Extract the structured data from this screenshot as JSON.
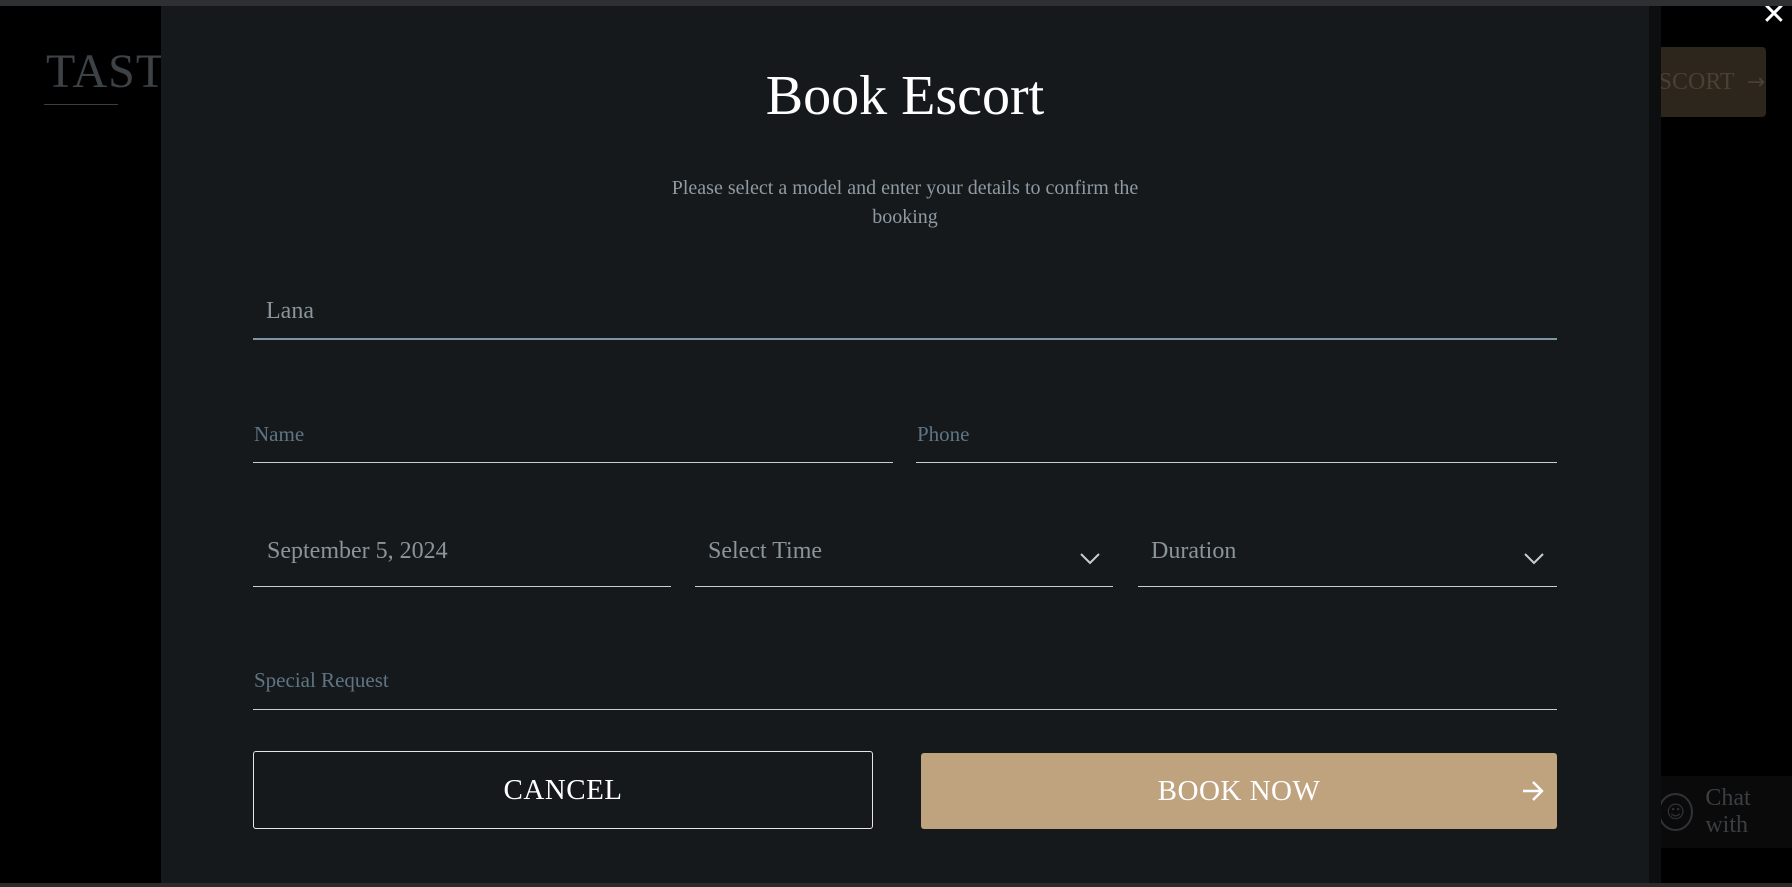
{
  "background": {
    "logo_text": "TASTE",
    "book_button_label": "ESCORT",
    "chat_label": "Chat with"
  },
  "modal": {
    "title": "Book Escort",
    "subtitle": "Please select a model and enter your details to confirm the booking",
    "close_icon": "close-icon",
    "model": {
      "value": "Lana"
    },
    "name": {
      "placeholder": "Name"
    },
    "phone": {
      "placeholder": "Phone"
    },
    "date": {
      "value": "September 5, 2024"
    },
    "time": {
      "value": "Select Time"
    },
    "duration": {
      "value": "Duration"
    },
    "special_request": {
      "placeholder": "Special Request"
    },
    "cancel_label": "CANCEL",
    "book_label": "BOOK NOW"
  },
  "colors": {
    "modal_bg": "#15191c",
    "accent": "#bfa27e",
    "text_muted": "#8f9aa2",
    "placeholder": "#5f7584"
  }
}
